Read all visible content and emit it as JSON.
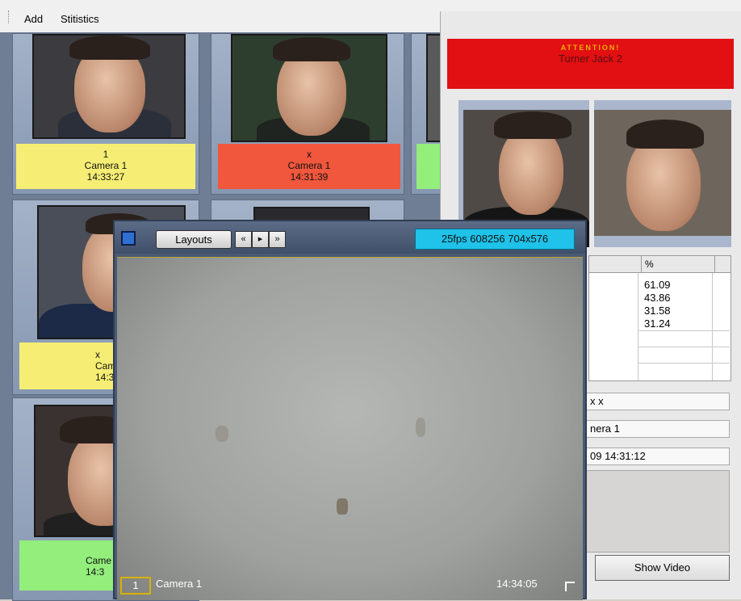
{
  "menu": {
    "items": [
      "Add",
      "Stitistics"
    ]
  },
  "cells": [
    {
      "tag_lines": [
        "1",
        "Camera 1",
        "14:33:27"
      ],
      "color": "yellow"
    },
    {
      "tag_lines": [
        "x",
        "Camera 1",
        "14:31:39"
      ],
      "color": "red"
    },
    {
      "tag_lines": [
        "x",
        "Came",
        "14:3"
      ],
      "color": "yellow"
    },
    {
      "tag_lines": [
        "Came",
        "14:3"
      ],
      "color": "green"
    }
  ],
  "alert": {
    "title": "ATTENTION!",
    "name": "Turner Jack 2",
    "table": {
      "header": "%",
      "values": [
        "61.09",
        "43.86",
        "31.58",
        "31.24"
      ]
    },
    "fields": [
      "x x",
      "nera 1",
      "09 14:31:12"
    ],
    "show_video_label": "Show Video"
  },
  "video": {
    "layouts_label": "Layouts",
    "nav": [
      "«",
      "▸",
      "»"
    ],
    "info": "25fps 608256 704x576",
    "channel": "1",
    "camera": "Camera 1",
    "time": "14:34:05"
  },
  "colors": {
    "yellow": "#f6ee74",
    "red": "#f0573c",
    "green": "#93ee7c",
    "alert": "#e20f13",
    "fps": "#1fc2e8"
  }
}
